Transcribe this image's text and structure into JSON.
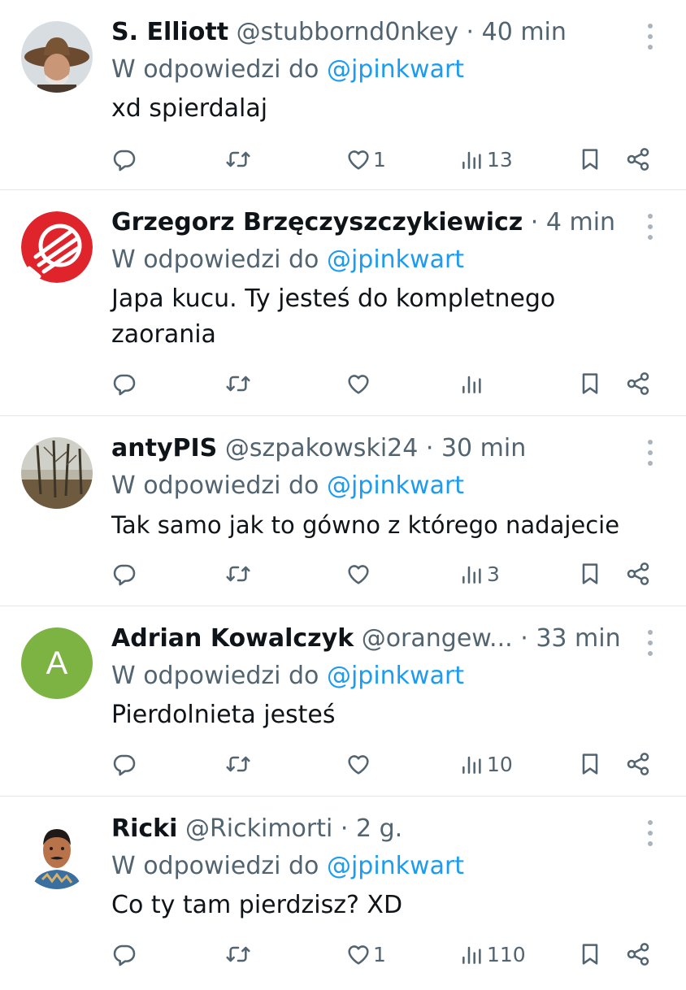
{
  "reply_prefix": "W odpowiedzi do",
  "tweets": [
    {
      "name": "S. Elliott",
      "handle": "@stubbornd0nkey",
      "dot": "·",
      "time": "40 min",
      "reply_to": "@jpinkwart",
      "text": "xd spierdalaj",
      "likes": "1",
      "views": "13",
      "avatar_icon": "cowboy-portrait"
    },
    {
      "name": "Grzegorz Brzęczyszczykiewicz",
      "handle": "",
      "dot": "·",
      "time": "4 min",
      "reply_to": "@jpinkwart",
      "text": "Japa kucu. Ty jesteś do kompletnego zaorania",
      "likes": "",
      "views": "",
      "avatar_icon": "red-crossed-emblem"
    },
    {
      "name": "antyPIS",
      "handle": "@szpakowski24",
      "dot": "·",
      "time": "30 min",
      "reply_to": "@jpinkwart",
      "text": "Tak samo jak to gówno z którego nadajecie",
      "likes": "",
      "views": "3",
      "avatar_icon": "forest-photo"
    },
    {
      "name": "Adrian Kowalczyk",
      "handle": "@orangew...",
      "dot": "·",
      "time": "33 min",
      "reply_to": "@jpinkwart",
      "text": "Pierdolnieta jesteś",
      "likes": "",
      "views": "10",
      "avatar_letter": "A",
      "avatar_color": "#7cb342"
    },
    {
      "name": "Ricki",
      "handle": "@Rickimorti",
      "dot": "·",
      "time": "2 g.",
      "reply_to": "@jpinkwart",
      "text": "Co ty tam pierdzisz? XD",
      "likes": "1",
      "views": "110",
      "avatar_icon": "man-portrait"
    }
  ],
  "colors": {
    "text": "#0f1419",
    "secondary": "#536471",
    "link": "#1d9bf0",
    "divider": "#e6e6e6"
  }
}
